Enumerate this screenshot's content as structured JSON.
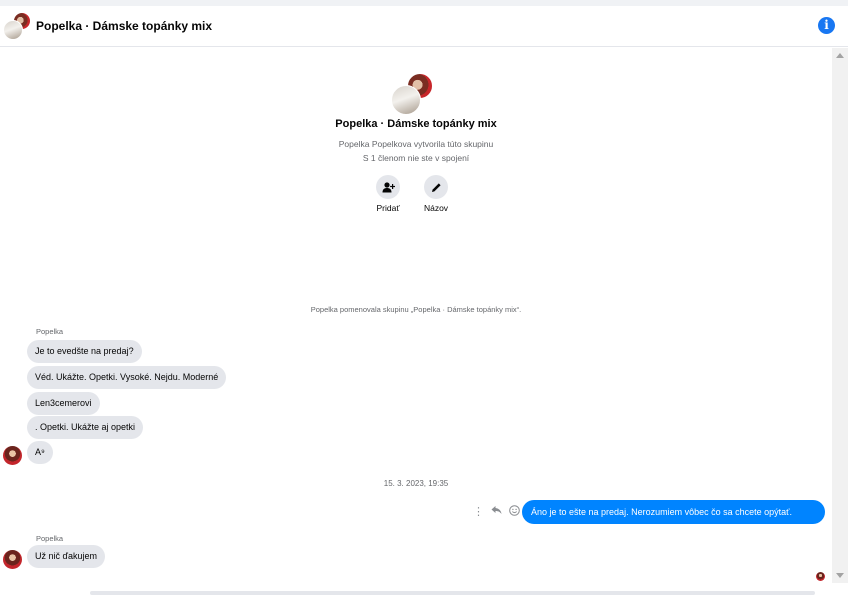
{
  "header": {
    "title": "Popelka · Dámske topánky mix",
    "info_icon_glyph": "i"
  },
  "group_intro": {
    "title": "Popelka · Dámske topánky mix",
    "creator_line": "Popelka Popelkova vytvorila túto skupinu",
    "connection_line": "S 1 členom nie ste v spojení",
    "actions": [
      {
        "label": "Pridať",
        "icon": "add-person-icon"
      },
      {
        "label": "Názov",
        "icon": "pencil-icon"
      }
    ]
  },
  "system_note": "Popelka pomenovala skupinu „Popelka · Dámske topánky mix“.",
  "thread_1": {
    "sender": "Popelka",
    "messages": [
      "Je to evedšte na predaj?",
      "Véd. Ukážte. Opetki. Vysoké.  Nejdu. Moderné",
      "Len3cemerovi",
      ". Opetki. Ukážte  aj opetki",
      "A⁹"
    ]
  },
  "date_divider": "15. 3. 2023, 19:35",
  "outgoing": {
    "text": "Áno je to ešte na predaj. Nerozumiem vôbec čo sa chcete opýtať."
  },
  "thread_2": {
    "sender": "Popelka",
    "messages": [
      "Už nič ďakujem"
    ]
  },
  "colors": {
    "accent": "#0084ff",
    "info": "#1877f2",
    "bubble_in": "#e4e6eb"
  }
}
